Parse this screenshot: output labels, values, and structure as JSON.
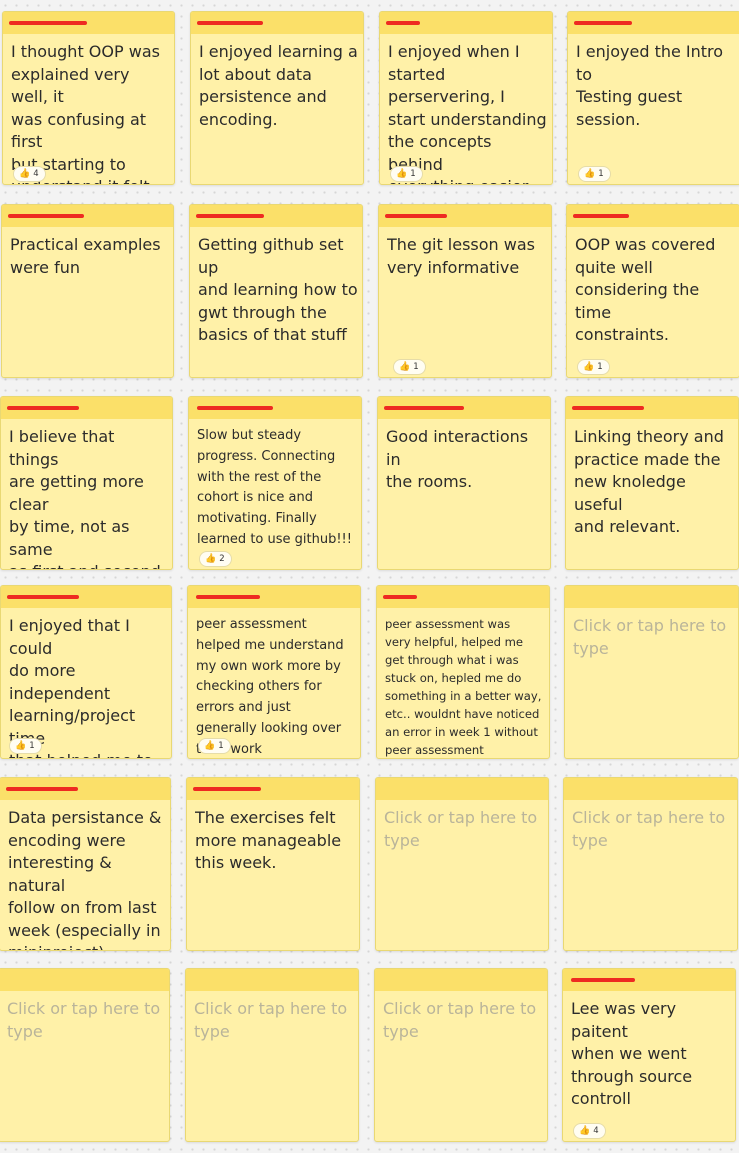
{
  "notes": [
    {
      "text": "I thought OOP was\nexplained very well, it\nwas confusing at first\nbut starting to\nunderstand it felt\nreally good",
      "likes": "4",
      "placeholder": false
    },
    {
      "text": "I enjoyed learning a\nlot about data\npersistence and\nencoding.",
      "likes": "",
      "placeholder": false
    },
    {
      "text": "I enjoyed when I\nstarted perservering, I\nstart understanding\nthe concepts behind\neverything easier.",
      "likes": "1",
      "placeholder": false
    },
    {
      "text": "I enjoyed the Intro to\nTesting guest session.",
      "likes": "1",
      "placeholder": false
    },
    {
      "text": "Practical examples\nwere fun",
      "likes": "",
      "placeholder": false
    },
    {
      "text": "Getting github set up\nand learning how to\ngwt through the\nbasics of that stuff",
      "likes": "",
      "placeholder": false
    },
    {
      "text": "The git lesson was\nvery informative",
      "likes": "1",
      "placeholder": false
    },
    {
      "text": "OOP was covered\nquite well\nconsidering the time\nconstraints.",
      "likes": "1",
      "placeholder": false
    },
    {
      "text": "I believe that things\nare getting more clear\nby time, not as same\nas first and second\nweek",
      "likes": "",
      "placeholder": false
    },
    {
      "text": "Slow but steady\nprogress. Connecting\nwith the rest of the\ncohort is nice and\nmotivating. Finally\nlearned to use github!!!",
      "likes": "2",
      "placeholder": false
    },
    {
      "text": "Good interactions in\nthe rooms.",
      "likes": "",
      "placeholder": false
    },
    {
      "text": "Linking theory and\npractice made the\nnew knoledge useful\nand relevant.",
      "likes": "",
      "placeholder": false
    },
    {
      "text": "I enjoyed that I could\ndo more independent\nlearning/project time\nthat helped me to\nfocus.",
      "likes": "1",
      "placeholder": false
    },
    {
      "text": "peer assessment\nhelped me understand\nmy own work more by\nchecking others for\nerrors and just\ngenerally looking over\ntheir work",
      "likes": "1",
      "placeholder": false
    },
    {
      "text": "peer assessment was\nvery helpful,  helped me\nget through what i was\nstuck on, hepled me do\nsomething in a better way,\netc.. wouldnt have noticed\nan error in week 1 without\npeer assessment",
      "likes": "",
      "placeholder": false
    },
    {
      "text": "Click or tap here to\ntype",
      "likes": "",
      "placeholder": true
    },
    {
      "text": "Data persistance &\nencoding were\ninteresting & natural\nfollow on from last\nweek (especially in\nminiproject)",
      "likes": "",
      "placeholder": false
    },
    {
      "text": "The exercises felt\nmore manageable\nthis week.",
      "likes": "",
      "placeholder": false
    },
    {
      "text": "Click or tap here to\ntype",
      "likes": "",
      "placeholder": true
    },
    {
      "text": "Click or tap here to\ntype",
      "likes": "",
      "placeholder": true
    },
    {
      "text": "Click or tap here to\ntype",
      "likes": "",
      "placeholder": true
    },
    {
      "text": "Click or tap here to\ntype",
      "likes": "",
      "placeholder": true
    },
    {
      "text": "Click or tap here to\ntype",
      "likes": "",
      "placeholder": true
    },
    {
      "text": "Lee was very paitent\nwhen we went\nthrough source\ncontroll",
      "likes": "4",
      "placeholder": false
    }
  ],
  "colors": {
    "note_body": "#fff1a8",
    "note_header": "#fbe069",
    "redaction": "#ee2a21",
    "placeholder_text": "#b9b49a"
  },
  "icons": {
    "like": "thumbs-up-icon"
  }
}
